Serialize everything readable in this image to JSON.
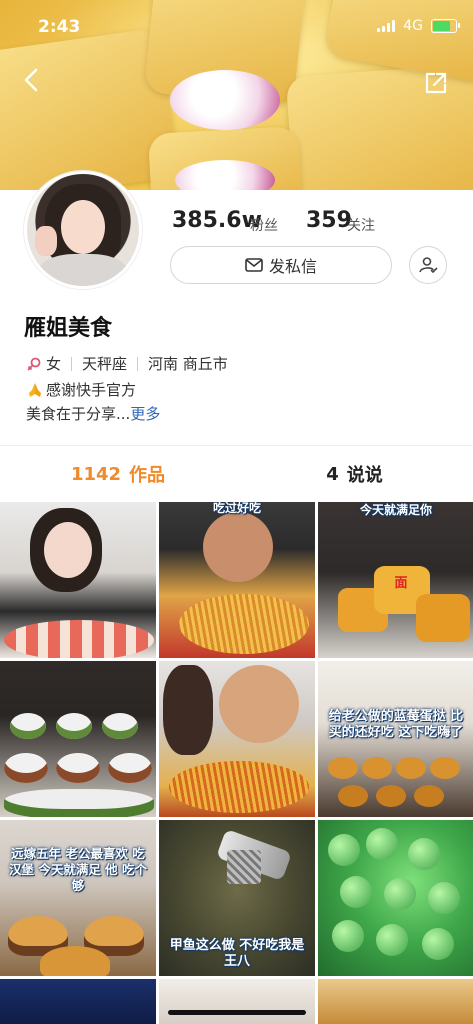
{
  "status_bar": {
    "time": "2:43",
    "network": "4G"
  },
  "profile": {
    "fans_count": "385.6w",
    "fans_label": "粉丝",
    "following_count": "359",
    "following_label": "关注",
    "message_button": "发私信",
    "name": "雁姐美食",
    "gender": "女",
    "zodiac": "天秤座",
    "location": "河南 商丘市",
    "bio_line1": "感谢快手官方",
    "bio_line2": "美食在于分享...",
    "bio_more": "更多"
  },
  "tabs": {
    "works_count": "1142",
    "works_label": "作品",
    "posts_count": "4",
    "posts_label": "说说"
  },
  "grid": {
    "captions": {
      "t2": "吃过好吃",
      "t3": "今天就满足你",
      "t6": "给老公做的蓝莓蛋挞 比买的还好吃 这下吃嗨了",
      "t7": "远嫁五年 老公最喜欢 吃汉堡 今天就满足 他 吃个够",
      "t8": "甲鱼这么做 不好吃我是王八"
    },
    "noodle_sign": "面"
  },
  "colors": {
    "accent": "#f08a2a",
    "link": "#2e66b8",
    "gender_icon": "#e0566f"
  }
}
